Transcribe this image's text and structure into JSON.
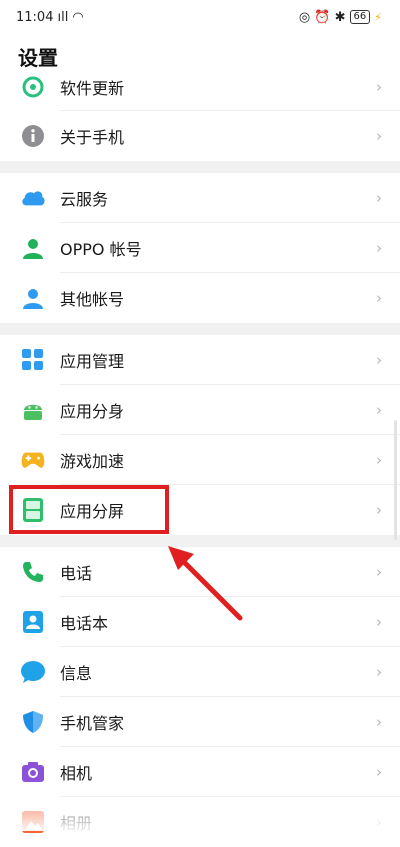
{
  "status_bar": {
    "time": "11:04",
    "signal": "ıll",
    "wifi": "◠",
    "right_icons": "◎ ⏰ ✱",
    "battery": "66",
    "charging": "⚡"
  },
  "page_title": "设置",
  "chevron": "›",
  "groups": [
    [
      {
        "id": "software-update",
        "label": "软件更新",
        "icon": "refresh-icon",
        "color": "#27c07f"
      },
      {
        "id": "about-phone",
        "label": "关于手机",
        "icon": "info-icon",
        "color": "#8e8e93"
      }
    ],
    [
      {
        "id": "cloud-service",
        "label": "云服务",
        "icon": "cloud-icon",
        "color": "#2f9bf0"
      },
      {
        "id": "oppo-account",
        "label": "OPPO 帐号",
        "icon": "user-icon",
        "color": "#20b15a"
      },
      {
        "id": "other-accounts",
        "label": "其他帐号",
        "icon": "user-icon",
        "color": "#2f9bf0"
      }
    ],
    [
      {
        "id": "app-management",
        "label": "应用管理",
        "icon": "grid-icon",
        "color": "#2f9bf0"
      },
      {
        "id": "app-clone",
        "label": "应用分身",
        "icon": "android-icon",
        "color": "#4cc060"
      },
      {
        "id": "game-acceleration",
        "label": "游戏加速",
        "icon": "gamepad-icon",
        "color": "#f5b21e"
      },
      {
        "id": "split-screen",
        "label": "应用分屏",
        "icon": "split-screen-icon",
        "color": "#2fbf6b"
      }
    ],
    [
      {
        "id": "phone",
        "label": "电话",
        "icon": "phone-icon",
        "color": "#23b35e"
      },
      {
        "id": "contacts",
        "label": "电话本",
        "icon": "contacts-icon",
        "color": "#1fa2e8"
      },
      {
        "id": "messages",
        "label": "信息",
        "icon": "message-icon",
        "color": "#1fa2e8"
      },
      {
        "id": "phone-manager",
        "label": "手机管家",
        "icon": "shield-icon",
        "color": "#1f8fe6"
      },
      {
        "id": "camera",
        "label": "相机",
        "icon": "camera-icon",
        "color": "#8b52d8"
      },
      {
        "id": "gallery",
        "label": "相册",
        "icon": "gallery-icon",
        "color": "#f2663a"
      }
    ]
  ],
  "annotation": {
    "highlight_color": "#e02020"
  }
}
